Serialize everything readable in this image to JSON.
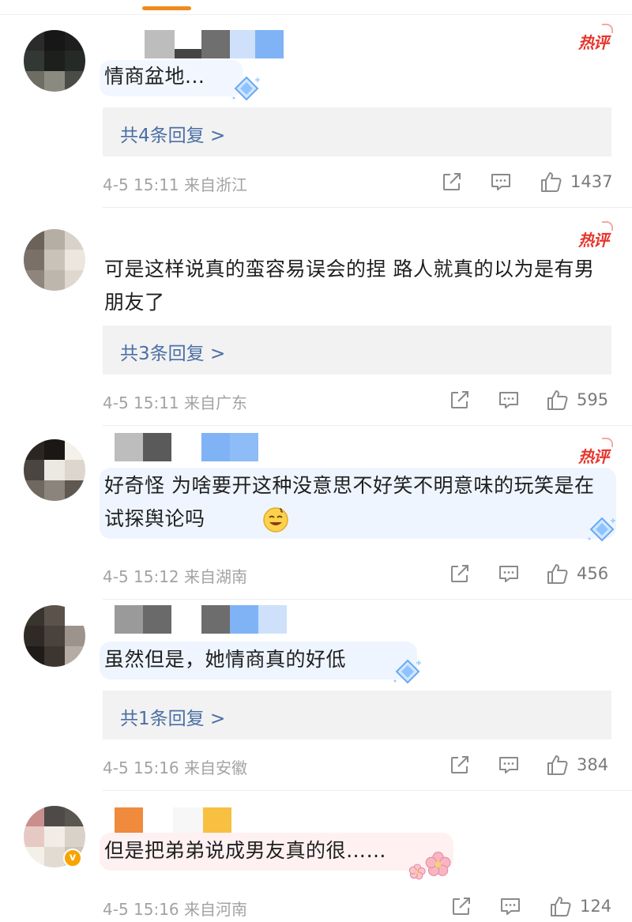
{
  "hot_badge_label": "热评",
  "comments": [
    {
      "text": "情商盆地...",
      "reply_label": "共4条回复 >",
      "meta": "4-5 15:11 来自浙江",
      "likes": "1437"
    },
    {
      "text": "可是这样说真的蛮容易误会的捏 路人就真的以为是有男朋友了",
      "reply_label": "共3条回复 >",
      "meta": "4-5 15:11 来自广东",
      "likes": "595"
    },
    {
      "text": "好奇怪 为啥要开这种没意思不好笑不明意味的玩笑是在试探舆论吗",
      "meta": "4-5 15:12 来自湖南",
      "likes": "456"
    },
    {
      "text": "虽然但是，她情商真的好低",
      "reply_label": "共1条回复 >",
      "meta": "4-5 15:16 来自安徽",
      "likes": "384"
    },
    {
      "text": "但是把弟弟说成男友真的很……",
      "meta": "4-5 15:16 来自河南",
      "likes": "124"
    }
  ],
  "icons": {
    "share": "share-icon",
    "comment": "comment-icon",
    "like": "thumbs-up-icon",
    "hot": "hot-comment-badge",
    "verified": "verified-v-badge",
    "emoji": "grinning-sweat-emoji",
    "decoration_diamond": "blue-diamond-decoration",
    "decoration_flower": "pink-flower-decoration"
  },
  "colors": {
    "accent_tab": "#f08a1c",
    "hot_badge": "#e8342c",
    "reply_link": "#4a6fa5",
    "reply_box_bg": "#f2f2f2",
    "meta_text": "#a3a3a3",
    "verified_badge": "#f7a400"
  }
}
